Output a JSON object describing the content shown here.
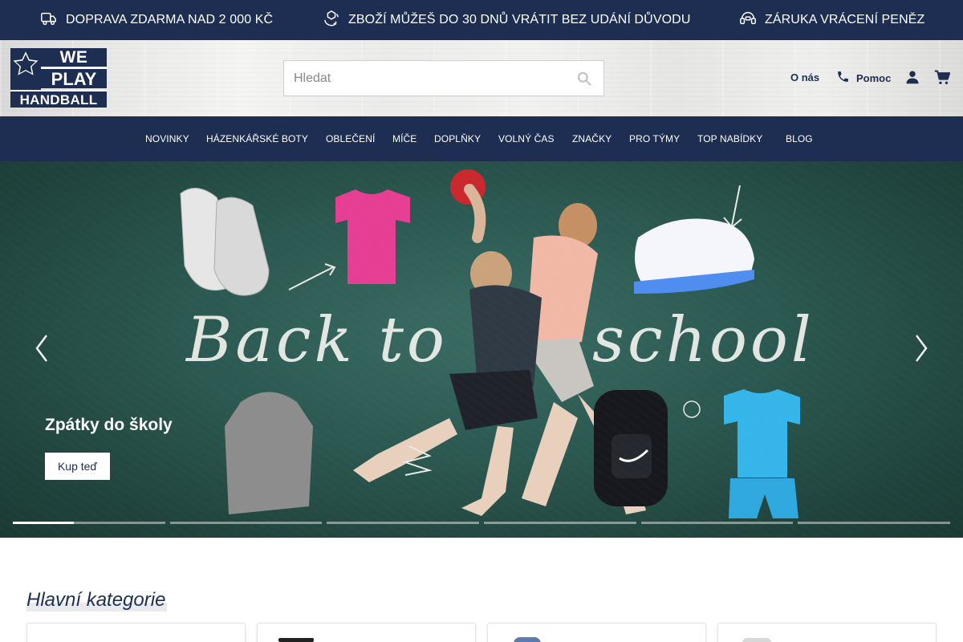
{
  "topbar": {
    "usps": [
      {
        "icon": "truck-icon",
        "text": "DOPRAVA ZDARMA NAD 2 000 KČ"
      },
      {
        "icon": "box-return-icon",
        "text": "ZBOŽÍ MŮŽEŠ DO 30 DNŮ VRÁTIT BEZ UDÁNÍ DŮVODU"
      },
      {
        "icon": "money-back-icon",
        "text": "ZÁRUKA VRÁCENÍ PENĚZ"
      }
    ]
  },
  "logo": {
    "line1": "WE",
    "line2": "PLAY",
    "line3": "HANDBALL"
  },
  "search": {
    "placeholder": "Hledat",
    "value": ""
  },
  "header_links": {
    "about": "O nás",
    "help": "Pomoc"
  },
  "nav": {
    "items": [
      "NOVINKY",
      "HÁZENKÁŘSKÉ BOTY",
      "OBLEČENÍ",
      "MÍČE",
      "DOPLŇKY",
      "VOLNÝ ČAS",
      "ZNAČKY",
      "PRO TÝMY",
      "TOP NABÍDKY",
      "BLOG"
    ]
  },
  "hero": {
    "chalk_text_left": "Back to",
    "chalk_text_right": "school",
    "title": "Zpátky do školy",
    "button": "Kup teď",
    "slides_count": 6,
    "active_slide": 1
  },
  "categories": {
    "heading": "Hlavní kategorie"
  },
  "colors": {
    "brand_navy": "#1e2d52",
    "hero_chalkboard": "#2c5a52"
  }
}
